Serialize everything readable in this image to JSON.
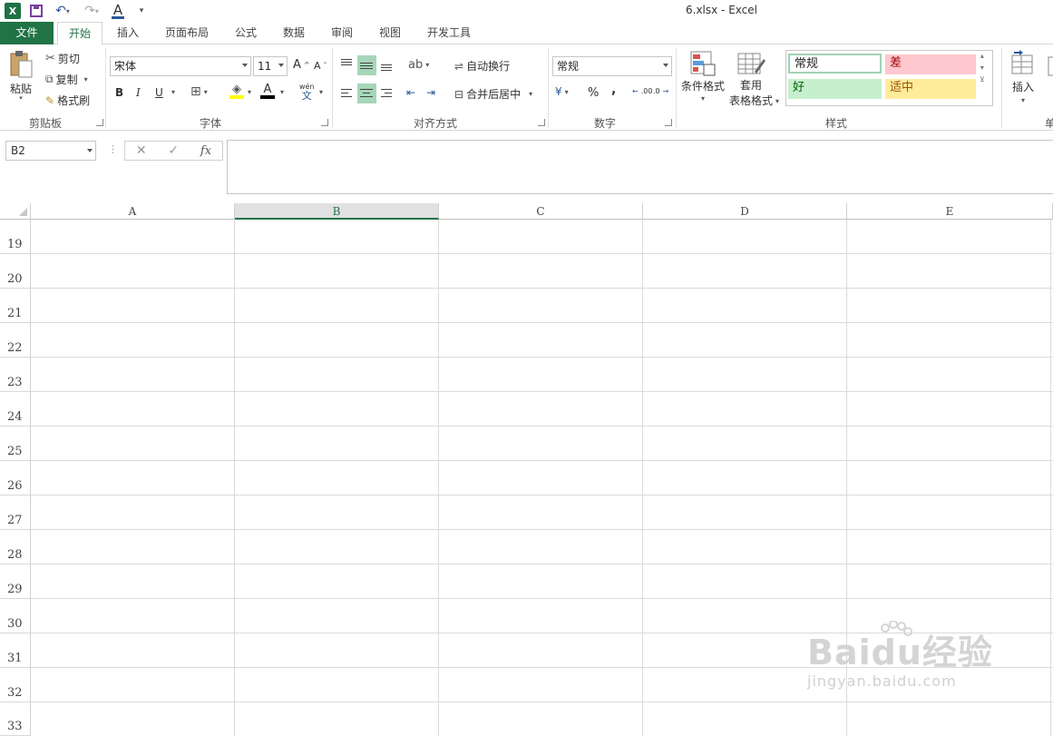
{
  "window": {
    "title": "6.xlsx - Excel"
  },
  "quick_access": {
    "icons": [
      "excel-icon",
      "save-icon",
      "undo-icon",
      "redo-icon",
      "font-color-icon",
      "customize-icon"
    ]
  },
  "tabs": [
    {
      "label": "文件",
      "active": false,
      "file": true
    },
    {
      "label": "开始",
      "active": true
    },
    {
      "label": "插入",
      "active": false
    },
    {
      "label": "页面布局",
      "active": false
    },
    {
      "label": "公式",
      "active": false
    },
    {
      "label": "数据",
      "active": false
    },
    {
      "label": "审阅",
      "active": false
    },
    {
      "label": "视图",
      "active": false
    },
    {
      "label": "开发工具",
      "active": false
    }
  ],
  "ribbon": {
    "clipboard": {
      "paste": "粘贴",
      "cut": "剪切",
      "copy": "复制",
      "format_painter": "格式刷",
      "label": "剪贴板"
    },
    "font": {
      "name": "宋体",
      "size": "11",
      "bold": "B",
      "italic": "I",
      "underline": "U",
      "pinyin": "wén",
      "pinyin_char": "文",
      "label": "字体"
    },
    "alignment": {
      "wrap": "自动换行",
      "merge": "合并后居中",
      "label": "对齐方式"
    },
    "number": {
      "format": "常规",
      "percent": "%",
      "comma": ",",
      "inc_decimal": ".00",
      "dec_decimal": ".0",
      "label": "数字"
    },
    "styles_group": {
      "conditional": "条件格式",
      "table_format_1": "套用",
      "table_format_2": "表格格式",
      "label": "样式",
      "normal": "常规",
      "bad": "差",
      "good": "好",
      "neutral": "适中",
      "colors": {
        "normal_border": "#6fbf8f",
        "bad_bg": "#ffc7ce",
        "bad_fg": "#9c0006",
        "good_bg": "#c6efce",
        "good_fg": "#006100",
        "neutral_bg": "#ffeb9c",
        "neutral_fg": "#9c5700"
      }
    },
    "cells": {
      "insert": "插入",
      "partial": "单"
    }
  },
  "formula_bar": {
    "name_box": "B2",
    "cancel": "✕",
    "enter": "✓",
    "fx": "fx",
    "value": ""
  },
  "grid": {
    "columns": [
      "A",
      "B",
      "C",
      "D",
      "E"
    ],
    "selected_column": "B",
    "rows": [
      "19",
      "20",
      "21",
      "22",
      "23",
      "24",
      "25",
      "26",
      "27",
      "28",
      "29",
      "30",
      "31",
      "32",
      "33"
    ]
  },
  "watermark": {
    "main": "Baidu经验",
    "sub": "jingyan.baidu.com"
  },
  "accent": "#217346"
}
